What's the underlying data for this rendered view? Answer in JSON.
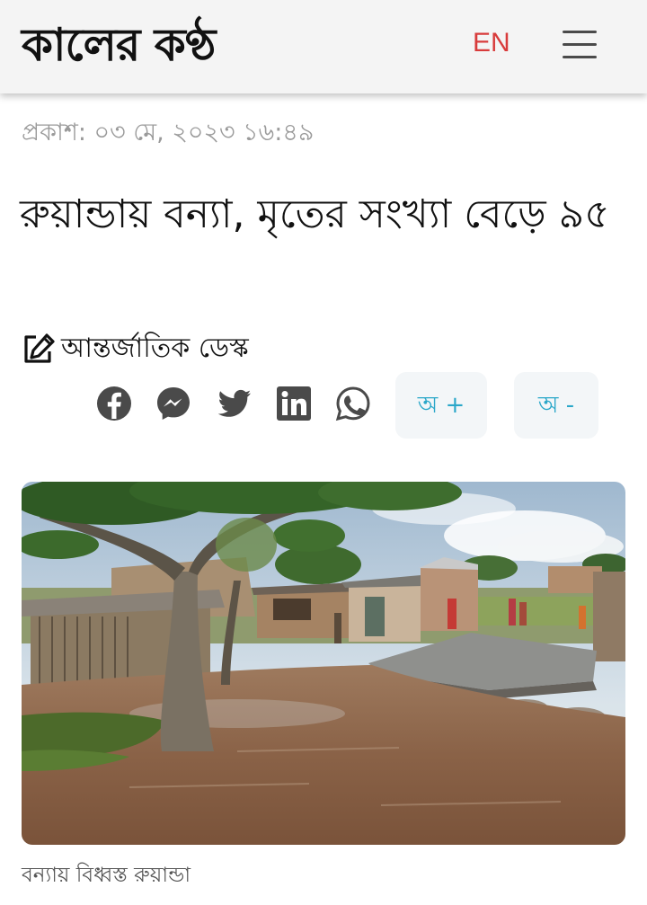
{
  "header": {
    "logo_text": "কালের কণ্ঠ",
    "lang_label": "EN",
    "menu_icon": "hamburger-menu-icon",
    "brand_color": "#d83b3b"
  },
  "article": {
    "published": "প্রকাশ: ০৩ মে, ২০২৩ ১৬:৪৯",
    "headline": "রুয়ান্ডায় বন্যা, মৃতের সংখ্যা বেড়ে ৯৫",
    "author": "আন্তর্জাতিক ডেস্ক",
    "author_icon": "edit-icon",
    "share_icons": [
      "facebook-icon",
      "messenger-icon",
      "twitter-icon",
      "linkedin-icon",
      "whatsapp-icon"
    ],
    "font_increase_label": "অ +",
    "font_decrease_label": "অ -",
    "accent_color": "#2aa7c9",
    "image_caption": "বন্যায় বিধ্বস্ত রুয়ান্ডা"
  }
}
